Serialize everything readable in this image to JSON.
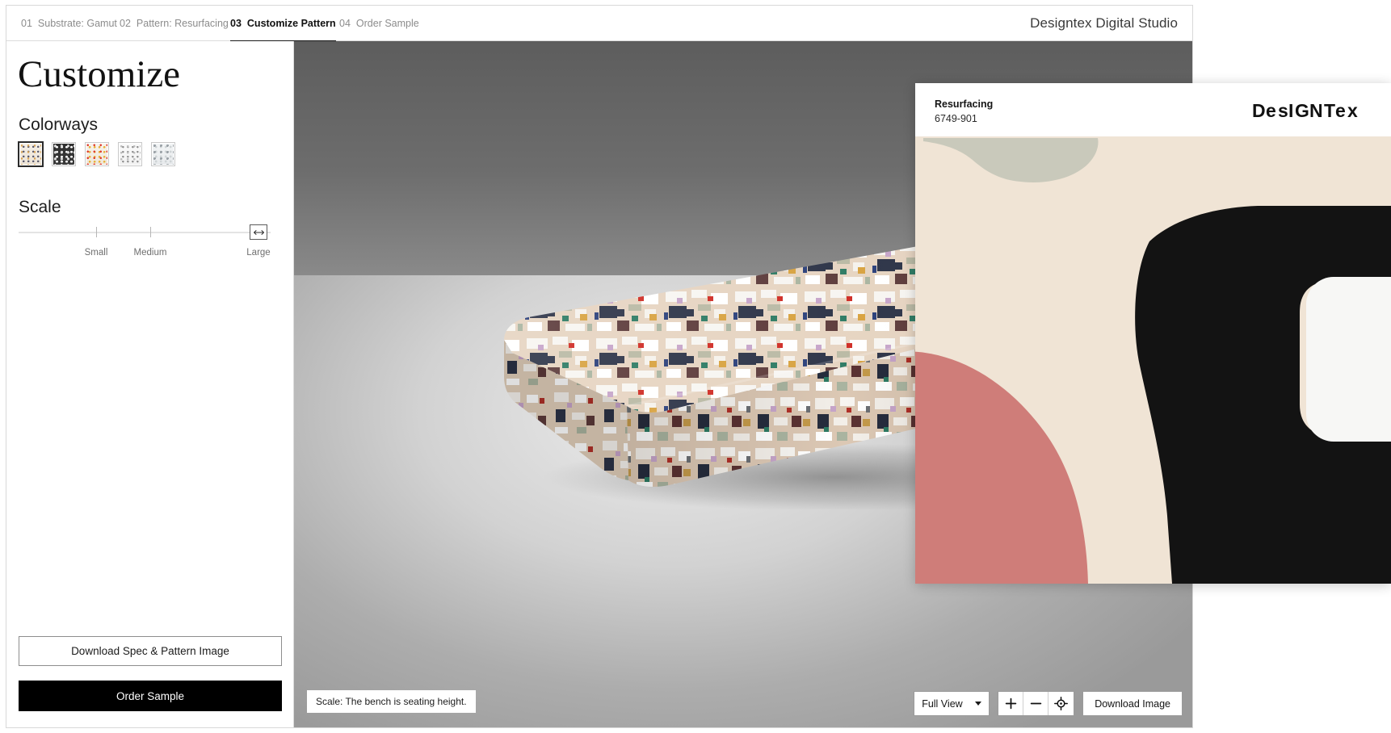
{
  "window": {
    "studio_title": "Designtex Digital Studio"
  },
  "stepper": {
    "steps": [
      {
        "num": "01",
        "label": "Substrate: Gamut",
        "active": false
      },
      {
        "num": "02",
        "label": "Pattern: Resurfacing",
        "active": false
      },
      {
        "num": "03",
        "label": "Customize Pattern",
        "active": true
      },
      {
        "num": "04",
        "label": "Order Sample",
        "active": false
      }
    ]
  },
  "sidebar": {
    "title": "Customize",
    "colorways": {
      "label": "Colorways",
      "selected_index": 0,
      "swatches": [
        {
          "name": "colorway-1"
        },
        {
          "name": "colorway-2"
        },
        {
          "name": "colorway-3"
        },
        {
          "name": "colorway-4"
        },
        {
          "name": "colorway-5"
        }
      ]
    },
    "scale": {
      "label": "Scale",
      "ticks": [
        "Small",
        "Medium",
        "Large"
      ],
      "value": "Large",
      "handle_icon": "resize-horizontal-icon"
    },
    "actions": {
      "download_spec": "Download Spec & Pattern Image",
      "order_sample": "Order Sample"
    }
  },
  "viewer": {
    "scale_caption": "Scale: The bench is seating height.",
    "toolbar": {
      "view_mode": "Full View",
      "zoom_in": "+",
      "zoom_out": "−",
      "recenter_icon": "target-icon",
      "download_image": "Download Image"
    }
  },
  "overlay": {
    "pattern_name": "Resurfacing",
    "pattern_code": "6749-901",
    "brand": "DESIGNTEX",
    "colors": {
      "cream": "#f0e4d5",
      "sage": "#c9c9bb",
      "rose": "#cf7d79",
      "black": "#131313",
      "white": "#f7f7f5"
    }
  }
}
